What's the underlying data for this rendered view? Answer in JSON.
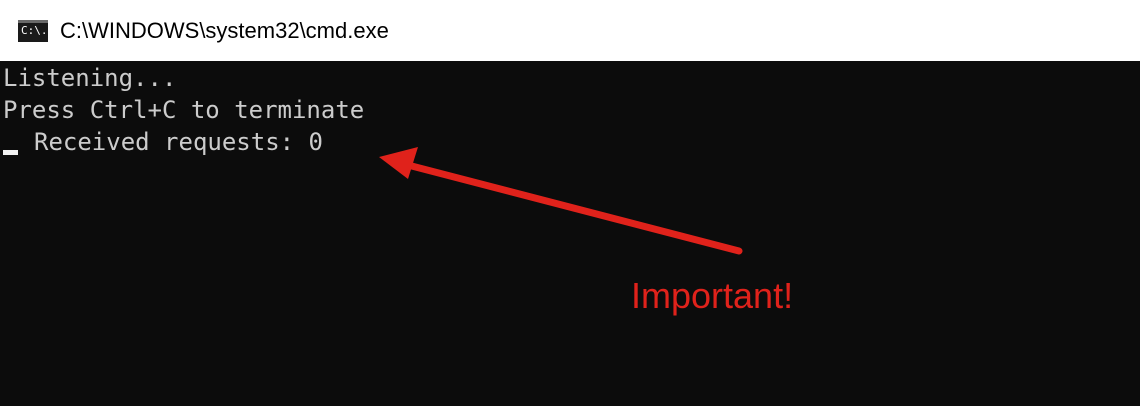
{
  "window": {
    "title": "C:\\WINDOWS\\system32\\cmd.exe",
    "icon": "cmd-icon",
    "icon_text": "C:\\."
  },
  "console": {
    "lines": [
      "Listening...",
      "Press Ctrl+C to terminate",
      "Received requests: 0"
    ],
    "background": "#0c0c0c",
    "text_color": "#cccccc"
  },
  "annotation": {
    "label": "Important!",
    "color": "#e0221b"
  }
}
